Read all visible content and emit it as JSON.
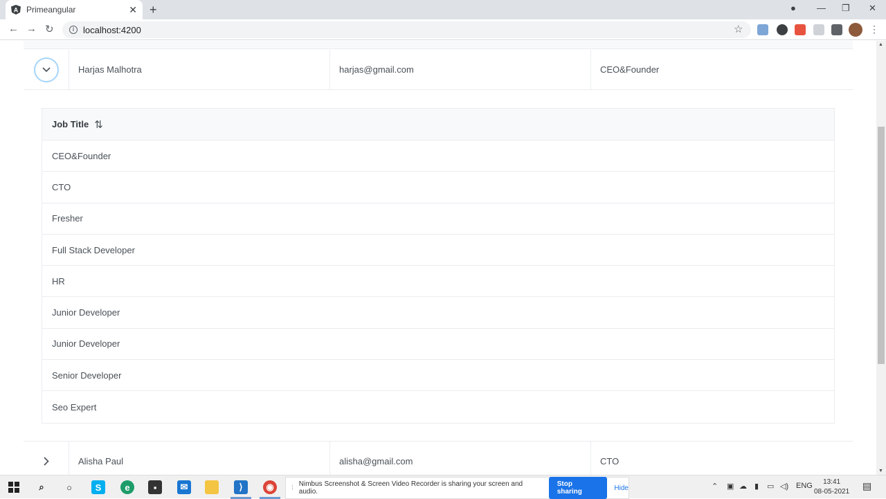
{
  "browser": {
    "tab_title": "Primeangular",
    "url": "localhost:4200"
  },
  "outer_rows": [
    {
      "name": "Harjas Malhotra",
      "email": "harjas@gmail.com",
      "job": "CEO&Founder",
      "expanded": true
    },
    {
      "name": "Alisha Paul",
      "email": "alisha@gmail.com",
      "job": "CTO",
      "expanded": false
    }
  ],
  "nested_table": {
    "header": "Job Title",
    "rows": [
      "CEO&Founder",
      "CTO",
      "Fresher",
      "Full Stack Developer",
      "HR",
      "Junior Developer",
      "Junior Developer",
      "Senior Developer",
      "Seo Expert"
    ]
  },
  "sharing_bar": {
    "message": "Nimbus Screenshot & Screen Video Recorder is sharing your screen and audio.",
    "stop_label": "Stop sharing",
    "hide_label": "Hide"
  },
  "taskbar": {
    "lang": "ENG",
    "time": "13:41",
    "date": "08-05-2021"
  },
  "icons": {
    "expand_open": "chevron-down-icon",
    "expand_closed": "chevron-right-icon",
    "sort": "sort-icon"
  }
}
